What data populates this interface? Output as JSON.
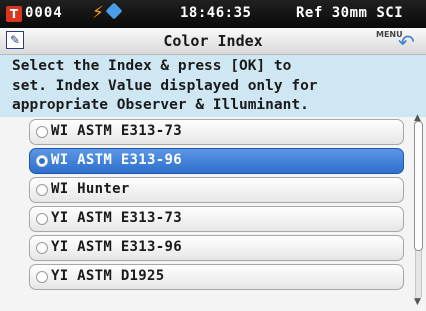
{
  "status_bar": {
    "target_icon": "T",
    "sample_number": "0004",
    "battery_icon": "charging-bolt",
    "bluetooth_icon": "bluetooth",
    "time": "18:46:35",
    "measurement_condition": "Ref 30mm SCI"
  },
  "title_bar": {
    "edit_icon": "pencil",
    "title": "Color Index",
    "menu_label": "MENU",
    "back_icon": "return-arrow"
  },
  "instruction": "Select the Index & press [OK] to\nset. Index Value displayed only for\nappropriate Observer & Illuminant.",
  "list": {
    "items": [
      {
        "label": "WI ASTM E313-73",
        "selected": false
      },
      {
        "label": "WI ASTM E313-96",
        "selected": true
      },
      {
        "label": "WI Hunter",
        "selected": false
      },
      {
        "label": "YI ASTM E313-73",
        "selected": false
      },
      {
        "label": "YI ASTM E313-96",
        "selected": false
      },
      {
        "label": "YI ASTM D1925",
        "selected": false
      }
    ]
  },
  "colors": {
    "selected_item": "#3a7ad8",
    "instruction_bg": "#cfe7f3",
    "status_bar_bg": "#111111"
  }
}
